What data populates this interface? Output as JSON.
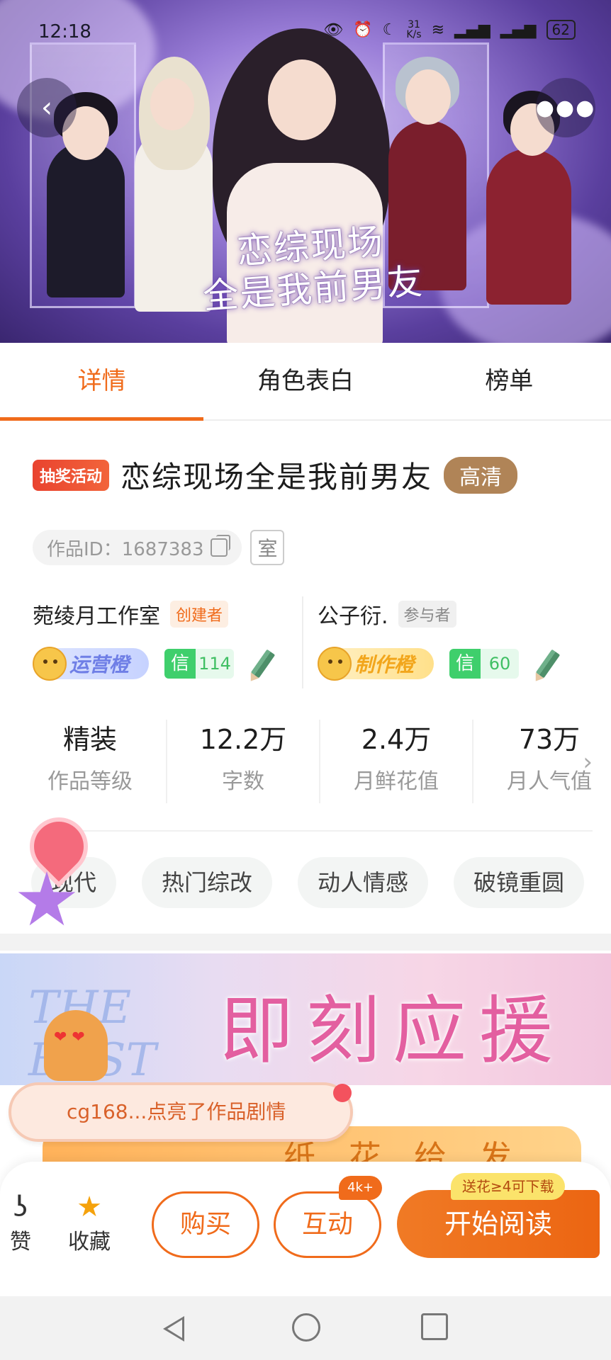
{
  "status_bar": {
    "time": "12:18",
    "net_speed_value": "31",
    "net_speed_unit": "K/s",
    "battery": "62"
  },
  "hero": {
    "title_line1": "恋综现场",
    "title_line2": "全是我前男友"
  },
  "tabs": [
    {
      "label": "详情",
      "active": true
    },
    {
      "label": "角色表白",
      "active": false
    },
    {
      "label": "榜单",
      "active": false
    }
  ],
  "work": {
    "activity_tag": "抽奖活动",
    "title": "恋综现场全是我前男友",
    "quality_tag": "高清",
    "id_text": "作品ID：1687383",
    "studio_short": "室"
  },
  "creators": [
    {
      "name": "菀绫月工作室",
      "role": "创建者",
      "rank_label": "运营橙",
      "credit_label": "信",
      "credit_value": "114"
    },
    {
      "name": "公子衍.",
      "role": "参与者",
      "rank_label": "制作橙",
      "credit_label": "信",
      "credit_value": "60"
    }
  ],
  "stats": [
    {
      "value": "精装",
      "label": "作品等级"
    },
    {
      "value": "12.2万",
      "label": "字数"
    },
    {
      "value": "2.4万",
      "label": "月鲜花值"
    },
    {
      "value": "73万",
      "label": "月人气值"
    }
  ],
  "genre_tags": [
    "现代",
    "热门综改",
    "动人情感",
    "破镜重圆"
  ],
  "banner": {
    "text": "即刻应援",
    "art_text": "THE BEST"
  },
  "toast": {
    "text": "cg168...点亮了作品剧情"
  },
  "peek": {
    "text": "纸花给发"
  },
  "bottom_bar": {
    "like_label": "赞",
    "favorite_label": "收藏",
    "buy_label": "购买",
    "interact_label": "互动",
    "interact_badge": "4k+",
    "read_label": "开始阅读",
    "read_tip": "送花≥4可下载"
  },
  "colors": {
    "accent": "#f06b1b",
    "credit_green": "#3fcf6c",
    "quality_tag": "#b08457"
  }
}
